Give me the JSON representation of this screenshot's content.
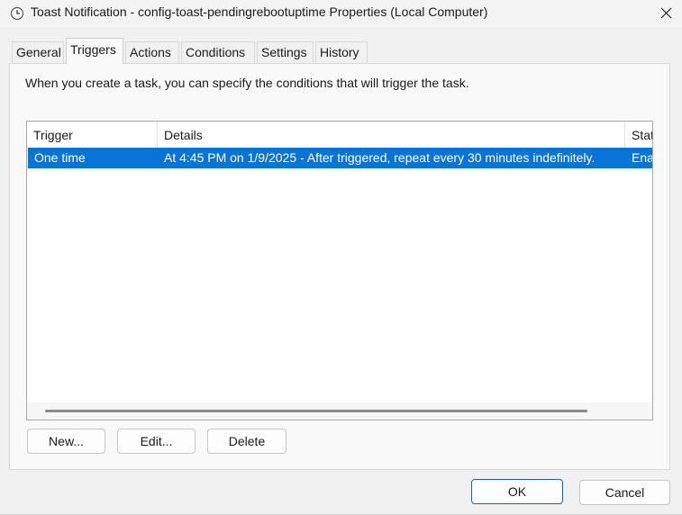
{
  "window": {
    "title": "Toast Notification - config-toast-pendingrebootuptime Properties (Local Computer)",
    "close_glyph": "✕"
  },
  "tabs": [
    {
      "label": "General",
      "active": false
    },
    {
      "label": "Triggers",
      "active": true
    },
    {
      "label": "Actions",
      "active": false
    },
    {
      "label": "Conditions",
      "active": false
    },
    {
      "label": "Settings",
      "active": false
    },
    {
      "label": "History",
      "active": false
    }
  ],
  "triggers": {
    "description": "When you create a task, you can specify the conditions that will trigger the task.",
    "columns": [
      "Trigger",
      "Details",
      "Stat"
    ],
    "rows": [
      {
        "trigger": "One time",
        "details": "At 4:45 PM on 1/9/2025 - After triggered, repeat every 30 minutes indefinitely.",
        "status": "Ena",
        "selected": true
      }
    ],
    "buttons": {
      "new": "New...",
      "edit": "Edit...",
      "delete": "Delete"
    }
  },
  "footer": {
    "ok": "OK",
    "cancel": "Cancel"
  },
  "colors": {
    "selection": "#0a74d6",
    "default_button_border": "#1a5fb4"
  }
}
